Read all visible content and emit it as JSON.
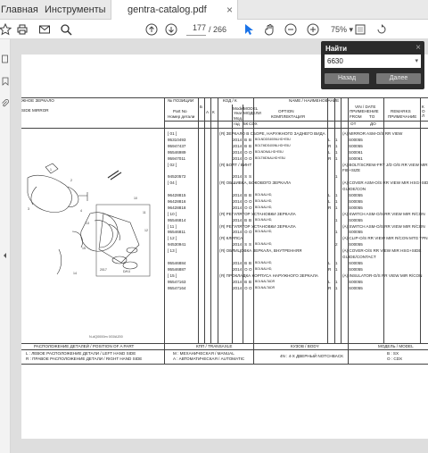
{
  "tabs": {
    "home": "Главная",
    "tools": "Инструменты",
    "doc": "gentra-catalog.pdf",
    "close": "×"
  },
  "toolbar": {
    "page_current": "177",
    "page_total": "/ 266",
    "zoom": "75%",
    "zoom_arrow": "▾"
  },
  "find": {
    "title": "Найти",
    "close": "×",
    "value": "6630",
    "dropdown": "▾",
    "back": "Назад",
    "next": "Далее"
  },
  "doc": {
    "title_ru": "ЖНОЕ ЗЕРКАЛО",
    "title_en": "SIDE MIRROR",
    "h_pos": "№ ПОЗИЦИИ",
    "h_part": "Part No",
    "h_partru": "Номер детали",
    "h_b": "Б",
    "h_a": "А",
    "h_k": "К",
    "h_kod": "КОД / К",
    "h_model": "Model",
    "h_year": "Year",
    "h_mod": "Мод.",
    "h_god": "год",
    "h_modelk": "MODEL",
    "h_modeli": "МОДЕЛИ",
    "h_5k": "5К",
    "h_cdx": "CDX",
    "h_name": "NAME / НАИМЕНОВАНИЕ",
    "h_opt": "OPTION",
    "h_compl": "КОМПЛЕКТАЦИЯ",
    "h_vin": "VIN / DATE",
    "h_app": "ПРИМЕНЕНИЕ",
    "h_from": "FROM",
    "h_to": "TO",
    "h_ot": "ОТ",
    "h_do": "ДО",
    "h_rem": "REMARKS",
    "h_prim": "ПРИМЕЧАНИЕ",
    "h_kol": "К О Л",
    "rows": [
      {
        "pos": "[ 01 ]",
        "part": "",
        "kod": "",
        "yr": "",
        "m1": "",
        "m2": "",
        "name": "(Я) ЗЕРКАЛО В СБОРЕ, НАРУЖНОГО ЗАДНЕГО ВИДА",
        "opt": "",
        "side": "",
        "q": "",
        "vin": "",
        "rem": "(A) MIRROR ASM-O/S RR VIEW"
      },
      {
        "pos": "95310493",
        "part": "",
        "kod": "",
        "yr": "2014",
        "m1": "B",
        "m2": "B",
        "name": "",
        "opt": "BOLNDDS400NLHD+E5U",
        "side": "L",
        "q": "1",
        "vin": "S00055",
        "rem": ""
      },
      {
        "pos": "95947437",
        "part": "",
        "kod": "",
        "yr": "2014",
        "m1": "B",
        "m2": "B",
        "name": "",
        "opt": "BOLTMDS400NLHD+E5U",
        "side": "R",
        "q": "1",
        "vin": "S00055",
        "rem": ""
      },
      {
        "pos": "95546989",
        "part": "",
        "kod": "",
        "yr": "2014",
        "m1": "O",
        "m2": "O",
        "name": "",
        "opt": "BOLNDNALHD+E5U",
        "side": "L",
        "q": "1",
        "vin": "S00061",
        "rem": ""
      },
      {
        "pos": "95947011",
        "part": "",
        "kod": "",
        "yr": "2014",
        "m1": "O",
        "m2": "O",
        "name": "",
        "opt": "BOLTMDNALHD+E5U",
        "side": "R",
        "q": "1",
        "vin": "S00061",
        "rem": ""
      },
      {
        "pos": "[ 02 ]",
        "part": "",
        "kod": "",
        "yr": "",
        "m1": "",
        "m2": "",
        "name": "(Я) БОЛТ / ВИНТ",
        "opt": "",
        "side": "",
        "q": "",
        "vin": "",
        "rem": "(A) BOLT/SCREW-FRT J/D O/S RR VIEW MIR"
      },
      {
        "pos": "",
        "part": "",
        "kod": "",
        "yr": "",
        "m1": "",
        "m2": "",
        "name": "",
        "opt": "",
        "side": "",
        "q": "",
        "vin": "",
        "rem": "FIE+SIZE"
      },
      {
        "pos": "94520572",
        "part": "",
        "kod": "",
        "yr": "2014",
        "m1": "S",
        "m2": "S",
        "name": "",
        "opt": "",
        "side": "",
        "q": "1",
        "vin": "",
        "rem": ""
      },
      {
        "pos": "[ 04 ]",
        "part": "",
        "kod": "",
        "yr": "",
        "m1": "",
        "m2": "",
        "name": "(Я) ОБШИВКА, БОКОВОГО ЗЕРКАЛА",
        "opt": "",
        "side": "",
        "q": "",
        "vin": "",
        "rem": "(A) COVER ASM-O/S RR VIEW MIR HSG+SIDE"
      },
      {
        "pos": "",
        "part": "",
        "kod": "",
        "yr": "",
        "m1": "",
        "m2": "",
        "name": "",
        "opt": "",
        "side": "",
        "q": "",
        "vin": "",
        "rem": "GUIDE/CON"
      },
      {
        "pos": "96428815",
        "part": "",
        "kod": "",
        "yr": "2014",
        "m1": "B",
        "m2": "B",
        "name": "",
        "opt": "BOLNALHD,",
        "side": "L",
        "q": "1",
        "vin": "S00055",
        "rem": ""
      },
      {
        "pos": "96428816",
        "part": "",
        "kod": "",
        "yr": "2014",
        "m1": "O",
        "m2": "O",
        "name": "",
        "opt": "BOLNALHD,",
        "side": "L",
        "q": "1",
        "vin": "S00055",
        "rem": ""
      },
      {
        "pos": "96428818",
        "part": "",
        "kod": "",
        "yr": "2014",
        "m1": "O",
        "m2": "O",
        "name": "",
        "opt": "BOLNALHD,",
        "side": "R",
        "q": "1",
        "vin": "S00055",
        "rem": ""
      },
      {
        "pos": "[ 10 ]",
        "part": "",
        "kod": "",
        "yr": "",
        "m1": "",
        "m2": "",
        "name": "(Я) РЕГУЛЯТОР УСТАНОВКИ ЗЕРКАЛА",
        "opt": "",
        "side": "",
        "q": "",
        "vin": "",
        "rem": "(A) SWITCH ASM-O/S RR VIEW MIR  R/CON"
      },
      {
        "pos": "95546814",
        "part": "",
        "kod": "",
        "yr": "2014",
        "m1": "B",
        "m2": "B",
        "name": "",
        "opt": "BOLNALHD,",
        "side": "",
        "q": "1",
        "vin": "S00055",
        "rem": ""
      },
      {
        "pos": "[ 11 ]",
        "part": "",
        "kod": "",
        "yr": "",
        "m1": "",
        "m2": "",
        "name": "(Я) РЕГУЛЯТОР УСТАНОВКИ ЗЕРКАЛА",
        "opt": "",
        "side": "",
        "q": "",
        "vin": "",
        "rem": "(A) SWITCH ASM-O/S RR VIEW MIR  R/CON"
      },
      {
        "pos": "95546811",
        "part": "",
        "kod": "",
        "yr": "2014",
        "m1": "O",
        "m2": "O",
        "name": "",
        "opt": "BOLNALHD,",
        "side": "",
        "q": "1",
        "vin": "S00055",
        "rem": ""
      },
      {
        "pos": "[ 12 ]",
        "part": "",
        "kod": "",
        "yr": "",
        "m1": "",
        "m2": "",
        "name": "(Я) КЛИПСА",
        "opt": "",
        "side": "",
        "q": "",
        "vin": "",
        "rem": "(A) CLIP-O/S RR VIEW MIR R/CON MTG TPNL"
      },
      {
        "pos": "94530941",
        "part": "",
        "kod": "",
        "yr": "2014",
        "m1": "S",
        "m2": "S",
        "name": "",
        "opt": "BOLNALHD,",
        "side": "",
        "q": "2",
        "vin": "S00055",
        "rem": ""
      },
      {
        "pos": "[ 13 ]",
        "part": "",
        "kod": "",
        "yr": "",
        "m1": "",
        "m2": "",
        "name": "(Я) ОБЛИЦОВКА ЗЕРКАЛА, ВНУТРЕННЯЯ",
        "opt": "",
        "side": "",
        "q": "",
        "vin": "",
        "rem": "(A) COVER-O/S RR VIEW MIR HSG+SIDE"
      },
      {
        "pos": "",
        "part": "",
        "kod": "",
        "yr": "",
        "m1": "",
        "m2": "",
        "name": "",
        "opt": "",
        "side": "",
        "q": "",
        "vin": "",
        "rem": "GUIDE/CONTACT"
      },
      {
        "pos": "95546884",
        "part": "",
        "kod": "",
        "yr": "2014",
        "m1": "B",
        "m2": "B",
        "name": "",
        "opt": "BOLNALHD,",
        "side": "L",
        "q": "1",
        "vin": "S00055",
        "rem": ""
      },
      {
        "pos": "95546887",
        "part": "",
        "kod": "",
        "yr": "2014",
        "m1": "O",
        "m2": "O",
        "name": "",
        "opt": "BOLNALHD,",
        "side": "R",
        "q": "1",
        "vin": "S00055",
        "rem": ""
      },
      {
        "pos": "[ 15 ]",
        "part": "",
        "kod": "",
        "yr": "",
        "m1": "",
        "m2": "",
        "name": "(Я) ПРОКЛАДКА КОРПУСА НАРУЖНОГО ЗЕРКАЛА",
        "opt": "",
        "side": "",
        "q": "",
        "vin": "",
        "rem": "(A) INSULATOR-O/S RR VIEW MIR  R/CON"
      },
      {
        "pos": "95547163",
        "part": "",
        "kod": "",
        "yr": "2014",
        "m1": "B",
        "m2": "B",
        "name": "",
        "opt": "BOLNALTADR",
        "side": "L",
        "q": "1",
        "vin": "S00055",
        "rem": ""
      },
      {
        "pos": "95547164",
        "part": "",
        "kod": "",
        "yr": "2014",
        "m1": "O",
        "m2": "O",
        "name": "",
        "opt": "BOLNALTADR",
        "side": "R",
        "q": "1",
        "vin": "S00055",
        "rem": ""
      }
    ],
    "caption": "N-dQ0000m 0G0A200",
    "f_loc": "РАСПОЛОЖЕНИЕ ДЕТАЛЕЙ / POSITION OF A PART",
    "f_l": "L : ЛЕВОЕ РАСПОЛОЖЕНИЕ ДЕТАЛИ / LEFT HAND SIDE",
    "f_r": "R : ПРАВОЕ РАСПОЛОЖЕНИЕ ДЕТАЛИ / RIGHT HAND SIDE",
    "f_kpp": "КПП / TRANSAXLE",
    "f_m": "M : МЕХАНИЧЕСКАЯ / MANUAL",
    "f_a": "A : АВТОМАТИЧЕСКАЯ / AUTOMATIC",
    "f_body": "КУЗОВ / BODY",
    "f_4n": "4N : 4-Х ДВЕРНЫЙ NOTCHBACK",
    "f_model": "МОДЕЛЬ / MODEL",
    "f_b": "B : SX",
    "f_o": "O : CDX",
    "callouts": [
      "1",
      "2",
      "3",
      "4",
      "5",
      "10",
      "11",
      "12",
      "13",
      "14",
      "15",
      "2017",
      "D/K4"
    ]
  }
}
